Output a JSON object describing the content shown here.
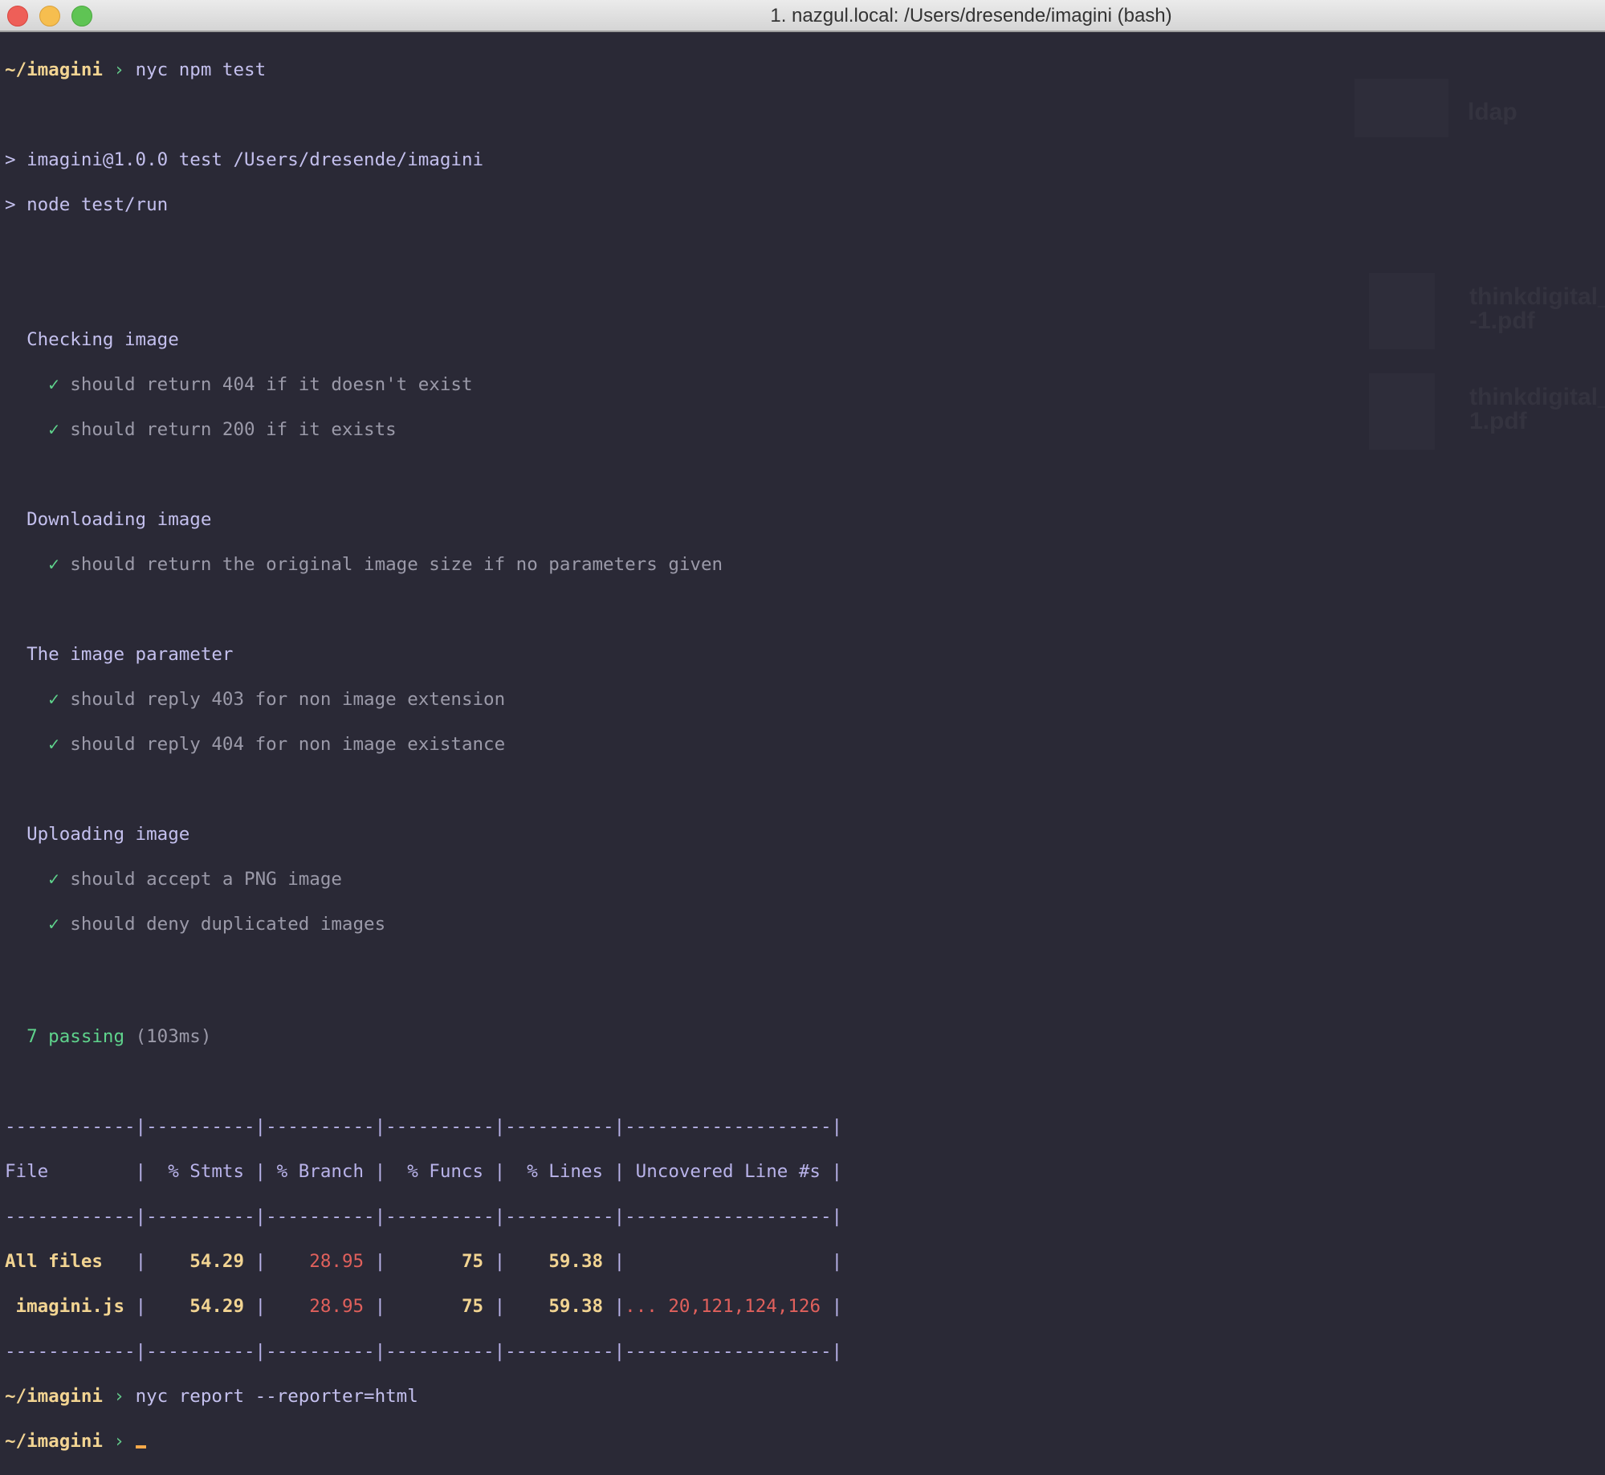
{
  "window": {
    "title": "1. nazgul.local: /Users/dresende/imagini (bash)"
  },
  "prompt": {
    "path": "~/imagini",
    "arrow": "›"
  },
  "commands": [
    "nyc npm test",
    "nyc report --reporter=html"
  ],
  "npm_output": [
    "> imagini@1.0.0 test /Users/dresende/imagini",
    "> node test/run"
  ],
  "suites": [
    {
      "title": "Checking image",
      "tests": [
        "should return 404 if it doesn't exist",
        "should return 200 if it exists"
      ]
    },
    {
      "title": "Downloading image",
      "tests": [
        "should return the original image size if no parameters given"
      ]
    },
    {
      "title": "The image parameter",
      "tests": [
        "should reply 403 for non image extension",
        "should reply 404 for non image existance"
      ]
    },
    {
      "title": "Uploading image",
      "tests": [
        "should accept a PNG image",
        "should deny duplicated images"
      ]
    }
  ],
  "check_glyph": "✓",
  "summary": {
    "passing": "7 passing",
    "duration": "(103ms)"
  },
  "coverage": {
    "separator": "------------|----------|----------|----------|----------|-------------------|",
    "header": "File        |  % Stmts | % Branch |  % Funcs |  % Lines | Uncovered Line #s |",
    "rows": [
      {
        "file": "All files",
        "stmts": "54.29",
        "branch": "28.95",
        "funcs": "75",
        "lines": "59.38",
        "uncovered": ""
      },
      {
        "file": "imagini.js",
        "stmts": "54.29",
        "branch": "28.95",
        "funcs": "75",
        "lines": "59.38",
        "uncovered": "... 20,121,124,126"
      }
    ]
  },
  "desktop_items": [
    {
      "icon": "folder-icon",
      "label": "ldap"
    },
    {
      "icon": "pdf-file-icon",
      "label": "thinkdigital_",
      "label2": "-1.pdf"
    },
    {
      "icon": "pdf-file-icon",
      "label": "thinkdigital_",
      "label2": "1.pdf"
    }
  ],
  "colors": {
    "background": "#2a2936",
    "path": "#f2d492",
    "command": "#c4c0ee",
    "pass": "#5fd38c",
    "fail": "#e0605c",
    "cursor": "#f7a94a"
  }
}
